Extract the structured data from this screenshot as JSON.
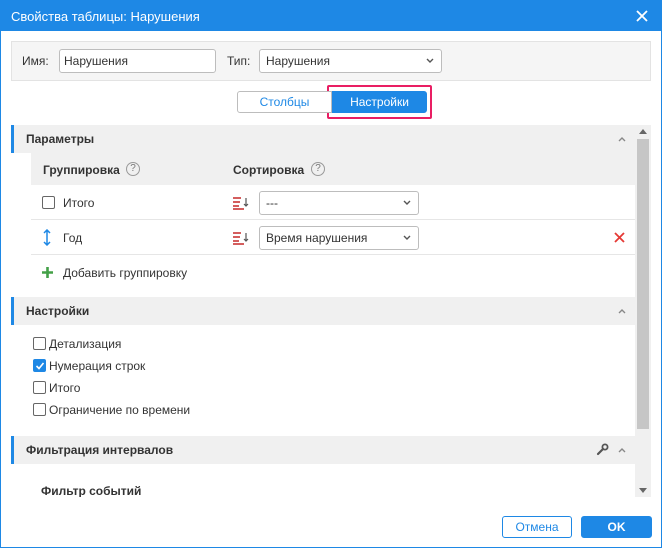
{
  "dialog": {
    "title": "Свойства таблицы: Нарушения",
    "accent_color": "#1e88e5",
    "highlight_color": "#e91e63"
  },
  "header": {
    "name_label": "Имя:",
    "name_value": "Нарушения",
    "type_label": "Тип:",
    "type_value": "Нарушения"
  },
  "tabs": [
    {
      "label": "Столбцы",
      "active": false
    },
    {
      "label": "Настройки",
      "active": true
    }
  ],
  "sections": {
    "params": {
      "title": "Параметры",
      "grouping_header": "Группировка",
      "sorting_header": "Сортировка",
      "rows": [
        {
          "name": "Итого",
          "sort_value": "---",
          "checked": false
        },
        {
          "name": "Год",
          "sort_value": "Время нарушения",
          "deletable": true
        }
      ],
      "add_grouping": "Добавить группировку"
    },
    "settings": {
      "title": "Настройки",
      "options": [
        {
          "label": "Детализация",
          "checked": false
        },
        {
          "label": "Нумерация строк",
          "checked": true
        },
        {
          "label": "Итого",
          "checked": false
        },
        {
          "label": "Ограничение по времени",
          "checked": false
        }
      ]
    },
    "interval_filter": {
      "title": "Фильтрация интервалов",
      "subtitle": "Фильтр событий"
    }
  },
  "footer": {
    "cancel_label": "Отмена",
    "ok_label": "OK"
  }
}
